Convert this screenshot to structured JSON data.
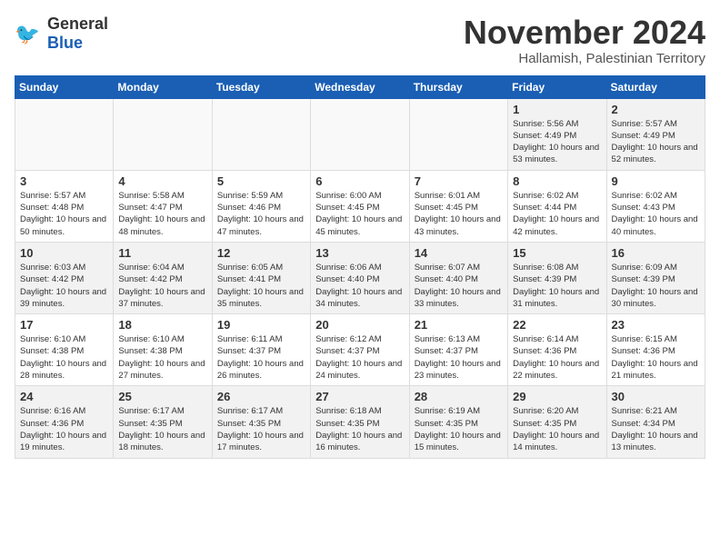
{
  "logo": {
    "general": "General",
    "blue": "Blue"
  },
  "title": {
    "month": "November 2024",
    "location": "Hallamish, Palestinian Territory"
  },
  "weekdays": [
    "Sunday",
    "Monday",
    "Tuesday",
    "Wednesday",
    "Thursday",
    "Friday",
    "Saturday"
  ],
  "weeks": [
    [
      {
        "day": "",
        "info": ""
      },
      {
        "day": "",
        "info": ""
      },
      {
        "day": "",
        "info": ""
      },
      {
        "day": "",
        "info": ""
      },
      {
        "day": "",
        "info": ""
      },
      {
        "day": "1",
        "info": "Sunrise: 5:56 AM\nSunset: 4:49 PM\nDaylight: 10 hours and 53 minutes."
      },
      {
        "day": "2",
        "info": "Sunrise: 5:57 AM\nSunset: 4:49 PM\nDaylight: 10 hours and 52 minutes."
      }
    ],
    [
      {
        "day": "3",
        "info": "Sunrise: 5:57 AM\nSunset: 4:48 PM\nDaylight: 10 hours and 50 minutes."
      },
      {
        "day": "4",
        "info": "Sunrise: 5:58 AM\nSunset: 4:47 PM\nDaylight: 10 hours and 48 minutes."
      },
      {
        "day": "5",
        "info": "Sunrise: 5:59 AM\nSunset: 4:46 PM\nDaylight: 10 hours and 47 minutes."
      },
      {
        "day": "6",
        "info": "Sunrise: 6:00 AM\nSunset: 4:45 PM\nDaylight: 10 hours and 45 minutes."
      },
      {
        "day": "7",
        "info": "Sunrise: 6:01 AM\nSunset: 4:45 PM\nDaylight: 10 hours and 43 minutes."
      },
      {
        "day": "8",
        "info": "Sunrise: 6:02 AM\nSunset: 4:44 PM\nDaylight: 10 hours and 42 minutes."
      },
      {
        "day": "9",
        "info": "Sunrise: 6:02 AM\nSunset: 4:43 PM\nDaylight: 10 hours and 40 minutes."
      }
    ],
    [
      {
        "day": "10",
        "info": "Sunrise: 6:03 AM\nSunset: 4:42 PM\nDaylight: 10 hours and 39 minutes."
      },
      {
        "day": "11",
        "info": "Sunrise: 6:04 AM\nSunset: 4:42 PM\nDaylight: 10 hours and 37 minutes."
      },
      {
        "day": "12",
        "info": "Sunrise: 6:05 AM\nSunset: 4:41 PM\nDaylight: 10 hours and 35 minutes."
      },
      {
        "day": "13",
        "info": "Sunrise: 6:06 AM\nSunset: 4:40 PM\nDaylight: 10 hours and 34 minutes."
      },
      {
        "day": "14",
        "info": "Sunrise: 6:07 AM\nSunset: 4:40 PM\nDaylight: 10 hours and 33 minutes."
      },
      {
        "day": "15",
        "info": "Sunrise: 6:08 AM\nSunset: 4:39 PM\nDaylight: 10 hours and 31 minutes."
      },
      {
        "day": "16",
        "info": "Sunrise: 6:09 AM\nSunset: 4:39 PM\nDaylight: 10 hours and 30 minutes."
      }
    ],
    [
      {
        "day": "17",
        "info": "Sunrise: 6:10 AM\nSunset: 4:38 PM\nDaylight: 10 hours and 28 minutes."
      },
      {
        "day": "18",
        "info": "Sunrise: 6:10 AM\nSunset: 4:38 PM\nDaylight: 10 hours and 27 minutes."
      },
      {
        "day": "19",
        "info": "Sunrise: 6:11 AM\nSunset: 4:37 PM\nDaylight: 10 hours and 26 minutes."
      },
      {
        "day": "20",
        "info": "Sunrise: 6:12 AM\nSunset: 4:37 PM\nDaylight: 10 hours and 24 minutes."
      },
      {
        "day": "21",
        "info": "Sunrise: 6:13 AM\nSunset: 4:37 PM\nDaylight: 10 hours and 23 minutes."
      },
      {
        "day": "22",
        "info": "Sunrise: 6:14 AM\nSunset: 4:36 PM\nDaylight: 10 hours and 22 minutes."
      },
      {
        "day": "23",
        "info": "Sunrise: 6:15 AM\nSunset: 4:36 PM\nDaylight: 10 hours and 21 minutes."
      }
    ],
    [
      {
        "day": "24",
        "info": "Sunrise: 6:16 AM\nSunset: 4:36 PM\nDaylight: 10 hours and 19 minutes."
      },
      {
        "day": "25",
        "info": "Sunrise: 6:17 AM\nSunset: 4:35 PM\nDaylight: 10 hours and 18 minutes."
      },
      {
        "day": "26",
        "info": "Sunrise: 6:17 AM\nSunset: 4:35 PM\nDaylight: 10 hours and 17 minutes."
      },
      {
        "day": "27",
        "info": "Sunrise: 6:18 AM\nSunset: 4:35 PM\nDaylight: 10 hours and 16 minutes."
      },
      {
        "day": "28",
        "info": "Sunrise: 6:19 AM\nSunset: 4:35 PM\nDaylight: 10 hours and 15 minutes."
      },
      {
        "day": "29",
        "info": "Sunrise: 6:20 AM\nSunset: 4:35 PM\nDaylight: 10 hours and 14 minutes."
      },
      {
        "day": "30",
        "info": "Sunrise: 6:21 AM\nSunset: 4:34 PM\nDaylight: 10 hours and 13 minutes."
      }
    ]
  ]
}
